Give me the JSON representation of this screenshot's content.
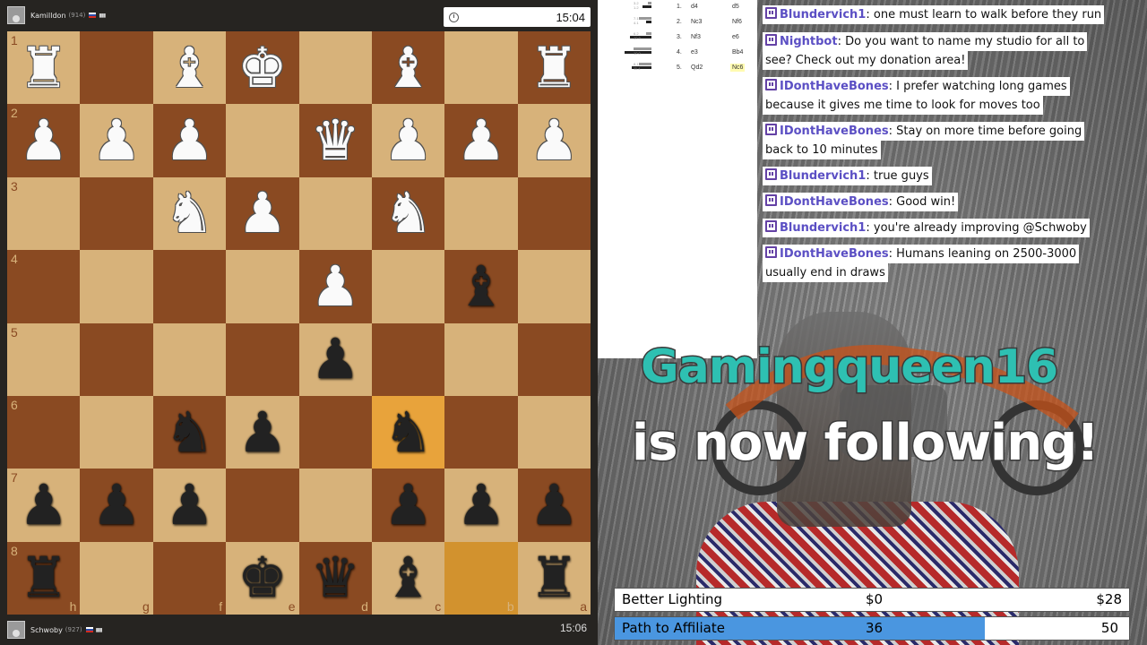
{
  "players": {
    "top": {
      "name": "Kamilldon",
      "rating": "(914)",
      "clock": "15:04"
    },
    "bottom": {
      "name": "Schwoby",
      "rating": "(927)",
      "clock": "15:06"
    }
  },
  "board": {
    "ranks": [
      "1",
      "2",
      "3",
      "4",
      "5",
      "6",
      "7",
      "8"
    ],
    "files": [
      "h",
      "g",
      "f",
      "e",
      "d",
      "c",
      "b",
      "a"
    ],
    "rows": [
      [
        "wR",
        "",
        "wB",
        "wK",
        "",
        "wB",
        "",
        "wR"
      ],
      [
        "wP",
        "wP",
        "wP",
        "",
        "wQ",
        "wP",
        "wP",
        "wP"
      ],
      [
        "",
        "",
        "wN",
        "wP",
        "",
        "wN",
        "",
        ""
      ],
      [
        "",
        "",
        "",
        "",
        "wP",
        "",
        "bB",
        ""
      ],
      [
        "",
        "",
        "",
        "",
        "bP",
        "",
        "",
        ""
      ],
      [
        "",
        "",
        "bN",
        "bP",
        "",
        "bN",
        "",
        ""
      ],
      [
        "bP",
        "bP",
        "bP",
        "",
        "",
        "bP",
        "bP",
        "bP"
      ],
      [
        "bR",
        "",
        "",
        "bK",
        "bQ",
        "bB",
        "",
        "bR"
      ]
    ]
  },
  "moves": [
    {
      "num": "1.",
      "white": "d4",
      "black": "d5",
      "tiny": "3.2\n1.2"
    },
    {
      "num": "2.",
      "white": "Nc3",
      "black": "Nf6",
      "tiny": "7.1\n4.1"
    },
    {
      "num": "3.",
      "white": "Nf3",
      "black": "e6",
      "tiny": "6.2\n10.9"
    },
    {
      "num": "4.",
      "white": "e3",
      "black": "Bb4",
      "tiny": "12.1\n10.0"
    },
    {
      "num": "5.",
      "white": "Qd2",
      "black": "Nc6",
      "tiny": "8.1\n11.4"
    }
  ],
  "chat": [
    {
      "user": "Blundervich1",
      "lines": [
        "one must learn to walk before they run"
      ]
    },
    {
      "user": "Nightbot",
      "lines": [
        "Do you want to name my studio for all to",
        "see? Check out my donation area!"
      ]
    },
    {
      "user": "IDontHaveBones",
      "lines": [
        "I prefer watching long games",
        "because it gives me time to look for moves too"
      ]
    },
    {
      "user": "IDontHaveBones",
      "lines": [
        "Stay on more time before going",
        "back to 10 minutes"
      ]
    },
    {
      "user": "Blundervich1",
      "lines": [
        "true guys"
      ]
    },
    {
      "user": "IDontHaveBones",
      "lines": [
        "Good win!"
      ]
    },
    {
      "user": "Blundervich1",
      "lines": [
        "you're already improving @Schwoby"
      ]
    },
    {
      "user": "IDontHaveBones",
      "lines": [
        "Humans leaning on 2500-3000",
        "usually end in draws"
      ]
    }
  ],
  "alert": {
    "name": "Gamingqueen16",
    "text": "is now following!"
  },
  "goals": [
    {
      "label": "Better Lighting",
      "current": "$0",
      "target": "$28",
      "progress": 0
    },
    {
      "label": "Path to Affiliate",
      "current": "36",
      "target": "50",
      "progress": 0.72
    }
  ],
  "colors": {
    "twitch": "#6441a5",
    "alert_name": "#2ec0b2",
    "goal_fill": "#4a96e0"
  }
}
